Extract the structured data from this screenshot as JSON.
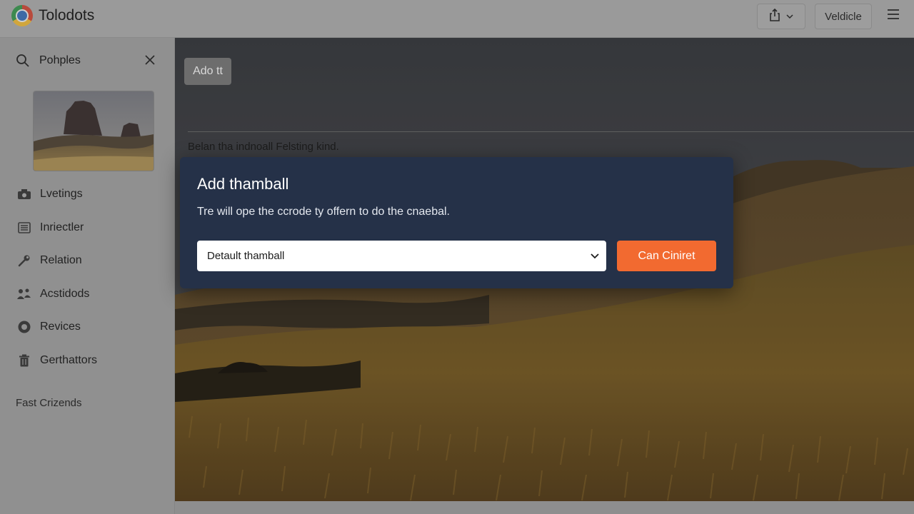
{
  "app": {
    "title": "Tolodots",
    "vehicle_label": "Veldicle"
  },
  "sidebar": {
    "search_text": "Pohples",
    "items": [
      {
        "label": "Lvetings",
        "icon": "camera-icon"
      },
      {
        "label": "Inriectler",
        "icon": "list-icon"
      },
      {
        "label": "Relation",
        "icon": "wrench-icon"
      },
      {
        "label": "Acstidods",
        "icon": "people-icon"
      },
      {
        "label": "Revices",
        "icon": "circle-icon"
      },
      {
        "label": "Gerthattors",
        "icon": "trash-icon"
      }
    ],
    "section_label": "Fast Crizends"
  },
  "main": {
    "add_it_label": "Ado  tt",
    "below_text": "Belan tha indnoall Felsting kind."
  },
  "dialog": {
    "title": "Add thamball",
    "description": "Tre will ope the ccrode ty offern to do the cnaebal.",
    "select_value": "Detault thamball",
    "confirm_label": "Can Ciniret"
  },
  "colors": {
    "dialog_bg": "#253148",
    "accent": "#f26a30"
  }
}
